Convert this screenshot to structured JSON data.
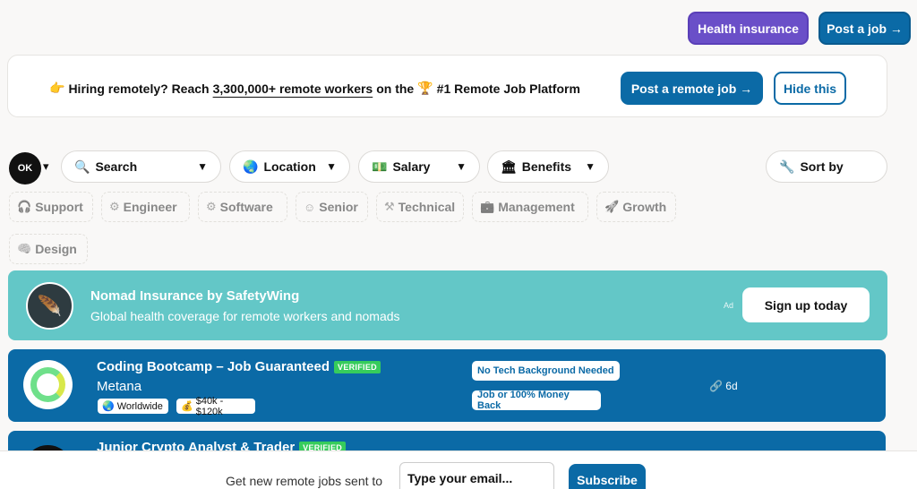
{
  "topbar": {
    "health_label": "Health insurance",
    "post_job_label": "Post a job →"
  },
  "banner": {
    "prefix": "Hiring remotely? Reach",
    "highlight": "3,300,000+ remote workers",
    "middle": "on the",
    "suffix": "#1 Remote Job Platform",
    "post_label": "Post a remote job →",
    "hide_label": "Hide this"
  },
  "logo": {
    "text": "OK"
  },
  "filters": {
    "search": "Search",
    "location": "Location",
    "salary": "Salary",
    "benefits": "Benefits",
    "sort": "Sort by"
  },
  "tags": [
    {
      "label": "Support",
      "icon": "headset-icon"
    },
    {
      "label": "Engineer",
      "icon": "engineer-icon"
    },
    {
      "label": "Software",
      "icon": "software-icon"
    },
    {
      "label": "Senior",
      "icon": "senior-icon"
    },
    {
      "label": "Technical",
      "icon": "tools-icon"
    },
    {
      "label": "Management",
      "icon": "briefcase-icon"
    },
    {
      "label": "Growth",
      "icon": "rocket-icon"
    },
    {
      "label": "Design",
      "icon": "design-icon"
    }
  ],
  "ad": {
    "title": "Nomad Insurance by SafetyWing",
    "subtitle": "Global health coverage for remote workers and nomads",
    "tag": "Ad",
    "cta": "Sign up today"
  },
  "jobs": [
    {
      "title": "Coding Bootcamp – Job Guaranteed",
      "badge": "VERIFIED",
      "company": "Metana",
      "location": "Worldwide",
      "salary": "$40k - $120k",
      "perks": [
        "No Tech Background Needed",
        "Job or 100% Money Back"
      ],
      "age": "6d"
    },
    {
      "title": "Junior Crypto Analyst & Trader",
      "badge": "VERIFIED"
    }
  ],
  "footer": {
    "text": "Get new remote jobs sent to",
    "placeholder": "Type your email...",
    "button": "Subscribe"
  },
  "colors": {
    "primary": "#0b6aa6",
    "health": "#6a4fc8",
    "ad_bg": "#63c7c7",
    "verified": "#36cc5c"
  }
}
